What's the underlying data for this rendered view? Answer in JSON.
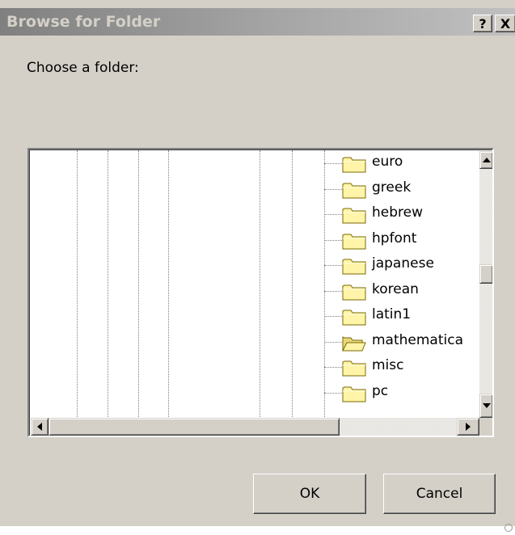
{
  "window": {
    "title": "Browse for Folder",
    "help_label": "?",
    "close_label": "X"
  },
  "prompt": "Choose a folder:",
  "tree": {
    "items": [
      {
        "label": "euro",
        "icon": "folder-icon"
      },
      {
        "label": "greek",
        "icon": "folder-icon"
      },
      {
        "label": "hebrew",
        "icon": "folder-icon"
      },
      {
        "label": "hpfont",
        "icon": "folder-icon"
      },
      {
        "label": "japanese",
        "icon": "folder-icon"
      },
      {
        "label": "korean",
        "icon": "folder-icon"
      },
      {
        "label": "latin1",
        "icon": "folder-icon"
      },
      {
        "label": "mathematica",
        "icon": "open-folder-icon"
      },
      {
        "label": "misc",
        "icon": "folder-icon"
      },
      {
        "label": "pc",
        "icon": "folder-icon"
      }
    ]
  },
  "buttons": {
    "ok": "OK",
    "cancel": "Cancel"
  },
  "colors": {
    "dialog_bg": "#d4d0c8",
    "title_gradient_start": "#808080",
    "folder_fill": "#fff4a8",
    "folder_stroke": "#7a6a00"
  }
}
